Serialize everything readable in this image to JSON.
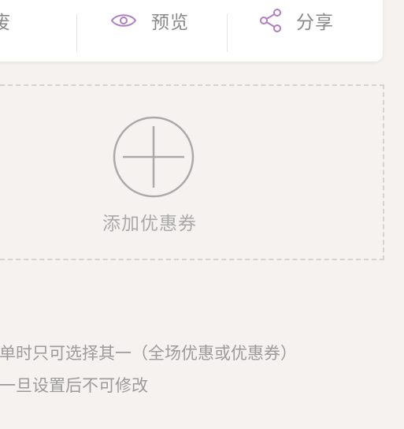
{
  "toolbar": {
    "void_label": "作废",
    "preview_label": "预览",
    "share_label": "分享"
  },
  "coupon": {
    "add_label": "添加优惠券"
  },
  "notes": [
    "下单时只可选择其一（全场优惠或优惠券）",
    "券一旦设置后不可修改"
  ],
  "colors": {
    "accent_icon": "#b07fbf",
    "background": "#f6f2ef",
    "muted_text": "#9b9b9b"
  },
  "icons": {
    "preview": "eye-icon",
    "share": "share-icon",
    "add": "plus-circle-icon"
  }
}
